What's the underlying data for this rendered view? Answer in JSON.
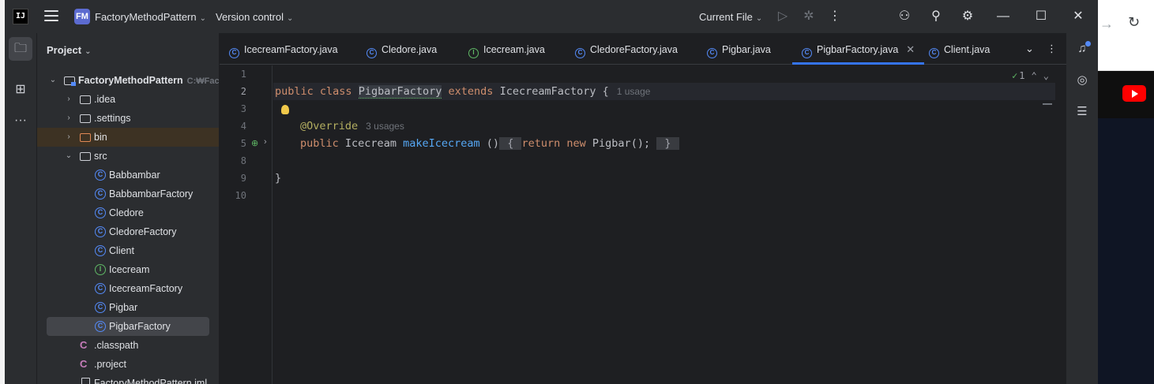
{
  "window": {
    "logo": "IJ",
    "project_badge": "FM",
    "project_name": "FactoryMethodPattern",
    "version_control": "Version control",
    "run_config": "Current File"
  },
  "project_panel": {
    "title": "Project",
    "tree": [
      {
        "label": "FactoryMethodPattern",
        "path": "C:₩Fact",
        "type": "module",
        "depth": 0,
        "expanded": true
      },
      {
        "label": ".idea",
        "type": "folder",
        "depth": 1,
        "expanded": false
      },
      {
        "label": ".settings",
        "type": "folder",
        "depth": 1,
        "expanded": false
      },
      {
        "label": "bin",
        "type": "folder-excluded",
        "depth": 1,
        "expanded": false
      },
      {
        "label": "src",
        "type": "folder",
        "depth": 1,
        "expanded": true
      },
      {
        "label": "Babbambar",
        "type": "class",
        "depth": 2
      },
      {
        "label": "BabbambarFactory",
        "type": "class",
        "depth": 2
      },
      {
        "label": "Cledore",
        "type": "class",
        "depth": 2
      },
      {
        "label": "CledoreFactory",
        "type": "class",
        "depth": 2
      },
      {
        "label": "Client",
        "type": "class",
        "depth": 2
      },
      {
        "label": "Icecream",
        "type": "interface",
        "depth": 2
      },
      {
        "label": "IcecreamFactory",
        "type": "class",
        "depth": 2
      },
      {
        "label": "Pigbar",
        "type": "class",
        "depth": 2
      },
      {
        "label": "PigbarFactory",
        "type": "class",
        "depth": 2,
        "selected": true
      },
      {
        "label": ".classpath",
        "type": "file",
        "depth": 1
      },
      {
        "label": ".project",
        "type": "file",
        "depth": 1
      },
      {
        "label": "FactoryMethodPattern.iml",
        "type": "iml",
        "depth": 1
      }
    ]
  },
  "tabs": [
    {
      "label": "IcecreamFactory.java",
      "icon": "class"
    },
    {
      "label": "Cledore.java",
      "icon": "class"
    },
    {
      "label": "Icecream.java",
      "icon": "interface"
    },
    {
      "label": "CledoreFactory.java",
      "icon": "class"
    },
    {
      "label": "Pigbar.java",
      "icon": "class"
    },
    {
      "label": "PigbarFactory.java",
      "icon": "class",
      "active": true
    },
    {
      "label": "Client.java",
      "icon": "class"
    }
  ],
  "editor": {
    "inspection_count": "1",
    "lines": [
      "1",
      "2",
      "3",
      "4",
      "5",
      "8",
      "9",
      "10"
    ],
    "code": {
      "l2_kw1": "public",
      "l2_kw2": "class",
      "l2_name": "PigbarFactory",
      "l2_kw3": "extends",
      "l2_super": "IcecreamFactory {",
      "l2_hint": "1 usage",
      "l4_ann": "@Override",
      "l4_hint": "3 usages",
      "l5_kw1": "public",
      "l5_type": "Icecream",
      "l5_fn": "makeIcecream",
      "l5_paren": "()",
      "l5_open": "{",
      "l5_kw2": "return",
      "l5_kw3": "new",
      "l5_ctor": "Pigbar();",
      "l5_close": "}",
      "l9_brace": "}"
    }
  },
  "colors": {
    "accent": "#3574f0",
    "keyword": "#cf8e6d",
    "function": "#56a8f5",
    "annotation": "#b3ae60",
    "class_icon": "#548af7",
    "interface_icon": "#5fb865"
  }
}
